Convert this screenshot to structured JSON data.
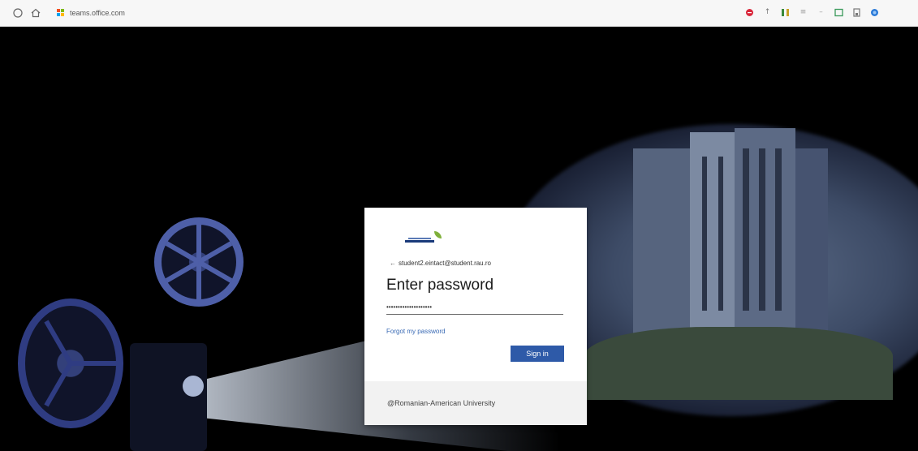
{
  "browser": {
    "back_icon": "back-icon",
    "home_icon": "home-icon",
    "url": "teams.office.com",
    "extensions": [
      {
        "name": "stop-extension-icon",
        "color": "#d9263a",
        "glyph": "●"
      },
      {
        "name": "pin-extension-icon",
        "color": "#777777",
        "glyph": "↑"
      },
      {
        "name": "bars-extension-icon",
        "color": "#3a8a3a",
        "glyph": "▐"
      },
      {
        "name": "list-extension-icon",
        "color": "#999999",
        "glyph": "≡"
      },
      {
        "name": "dash-extension-icon",
        "color": "#999999",
        "glyph": "–"
      },
      {
        "name": "calendar-extension-icon",
        "color": "#3a9a5a",
        "glyph": "▢"
      },
      {
        "name": "save-extension-icon",
        "color": "#777777",
        "glyph": "▣"
      },
      {
        "name": "globe-extension-icon",
        "color": "#2a7ad8",
        "glyph": "◉"
      }
    ]
  },
  "signin": {
    "email": "student2.eintact@student.rau.ro",
    "back_arrow": "←",
    "title": "Enter password",
    "password_masked": "••••••••••••••••••••",
    "forgot_label": "Forgot my password",
    "signin_label": "Sign in",
    "footer": "@Romanian-American University"
  },
  "colors": {
    "primary_button": "#2e5aa8",
    "link": "#3b6bb5"
  }
}
